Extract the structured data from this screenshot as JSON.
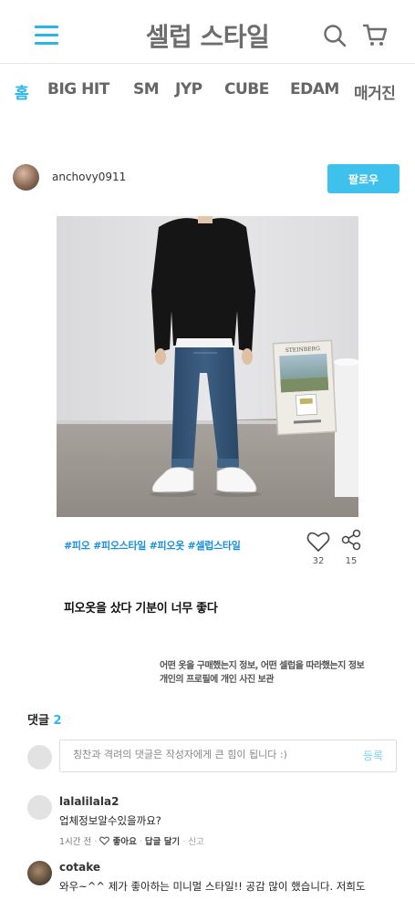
{
  "header": {
    "title": "셀럽 스타일",
    "menu_icon": "hamburger-menu-icon",
    "search_icon": "search-icon",
    "cart_icon": "cart-icon",
    "accent_color": "#29b6e8"
  },
  "nav": {
    "items": [
      "홈",
      "BIG HIT",
      "SM",
      "JYP",
      "CUBE",
      "EDAM",
      "매거진"
    ],
    "active": "홈"
  },
  "post": {
    "author": "anchovy0911",
    "follow_label": "팔로우",
    "tags": "#피오 #피오스타일 #피오옷 #셀럽스타일",
    "likes": "32",
    "shares": "15",
    "caption": "피오옷을 샀다 기분이 너무 좋다",
    "notice_line1": "어떤 옷을 구매했는지 정보, 어떤 셀럽을 따라했는지 정보",
    "notice_line2": "개인의 프로필에 개인 사진 보관",
    "artwork_label": "STEINBERG"
  },
  "comments": {
    "label": "댓글",
    "count": "2",
    "placeholder": "칭찬과 격려의 댓글은 작성자에게 큰 힘이 됩니다 :)",
    "submit_label": "등록",
    "items": [
      {
        "user": "lalalilala2",
        "text": "업체정보알수있을까요?",
        "time": "1시간 전",
        "like_label": "좋아요",
        "reply_label": "답글 달기",
        "report_label": "신고"
      },
      {
        "user": "cotake",
        "text": "와우~^^ 제가 좋아하는 미니멀 스타일!! 공감 많이 했습니다. 저희도"
      }
    ]
  }
}
